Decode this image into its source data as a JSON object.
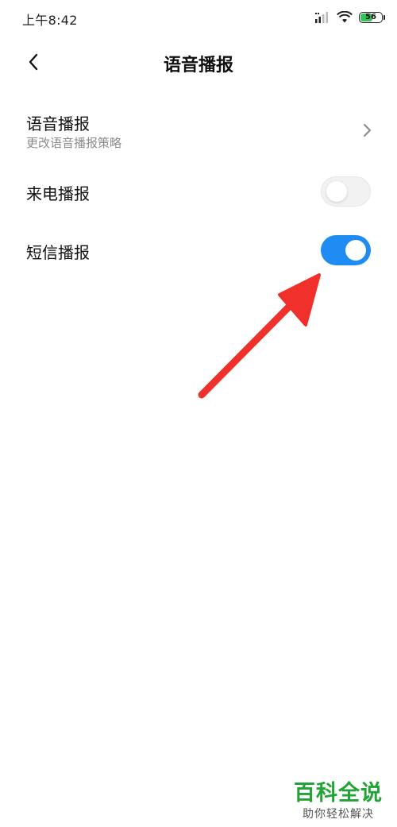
{
  "status_bar": {
    "time": "上午8:42",
    "battery_level": "56",
    "icons": [
      "signal-icon",
      "wifi-icon",
      "battery-icon"
    ]
  },
  "header": {
    "title": "语音播报",
    "back_icon": "chevron-left-icon"
  },
  "settings": {
    "voice_broadcast": {
      "title": "语音播报",
      "subtitle": "更改语音播报策略"
    },
    "incoming_call": {
      "title": "来电播报",
      "enabled": false
    },
    "sms": {
      "title": "短信播报",
      "enabled": true
    }
  },
  "watermark": {
    "title": "百科全说",
    "subtitle": "助你轻松解决"
  },
  "colors": {
    "toggle_on": "#1e8cf2",
    "toggle_off": "#f2f2f2",
    "annotation_arrow": "#f0302a",
    "watermark_green": "#21a336"
  }
}
